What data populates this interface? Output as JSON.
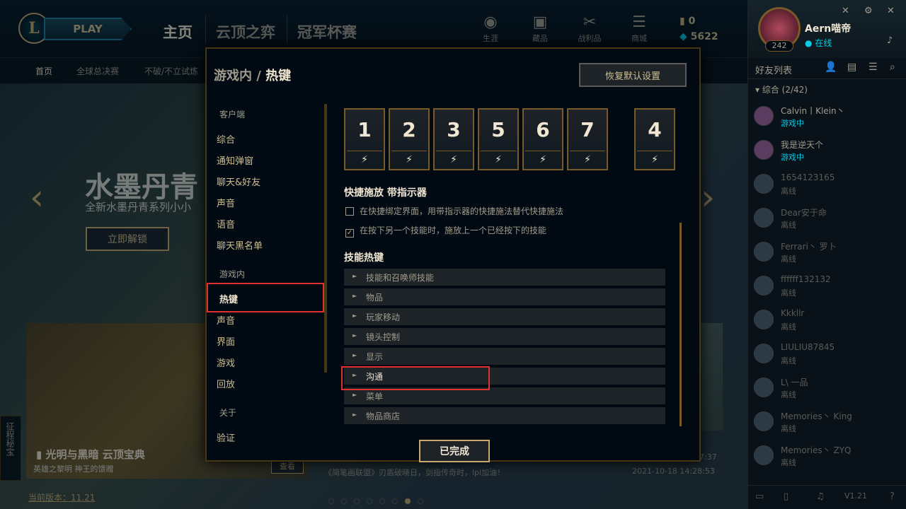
{
  "topbar": {
    "logo": "L",
    "play": "PLAY",
    "nav": [
      "主页",
      "云顶之弈",
      "冠军杯赛"
    ],
    "icons": [
      {
        "label": "生涯",
        "icon": "profile-icon"
      },
      {
        "label": "藏品",
        "icon": "collection-icon"
      },
      {
        "label": "战利品",
        "icon": "loot-icon"
      },
      {
        "label": "商城",
        "icon": "store-icon"
      }
    ],
    "blue_essence": "0",
    "rp": "5622"
  },
  "subnav": [
    "首页",
    "全球总决赛",
    "不破/不立试炼"
  ],
  "background": {
    "title": "水墨丹青",
    "subtitle": "全新水墨丹青系列小小",
    "unlock": "立即解锁",
    "card_title": "光明与黑暗 云顶宝典",
    "card_subtitle": "英雄之黎明 神王的馈赠",
    "card_btn": "查看",
    "news": "《简笔画联盟》刃盾破晓日，剑指传奇时，lpl加油！",
    "news_date": "2021-10-18 14:28:53",
    "news_date2": "7:37",
    "version": "当前版本：11.21",
    "sidetab": "征程秘宝"
  },
  "profile": {
    "name": "Aern喵帝",
    "status": "在线",
    "level": "242"
  },
  "friends": {
    "title": "好友列表",
    "group": "综合 (2/42)",
    "list": [
      {
        "name": "Calvin丨Klein丶",
        "status": "游戏中"
      },
      {
        "name": "我是逆天个",
        "status": "游戏中"
      },
      {
        "name": "1654123165",
        "status": "离线"
      },
      {
        "name": "Dear安于命",
        "status": "离线"
      },
      {
        "name": "Ferrari丶 罗卜",
        "status": "离线"
      },
      {
        "name": "ffffff132132",
        "status": "离线"
      },
      {
        "name": "Kkkllr",
        "status": "离线"
      },
      {
        "name": "LIULIU87845",
        "status": "离线"
      },
      {
        "name": "L\\ 一品",
        "status": "离线"
      },
      {
        "name": "Memories丶 King",
        "status": "离线"
      },
      {
        "name": "Memories丶 ZYQ",
        "status": "离线"
      }
    ],
    "footer_version": "V1.21"
  },
  "modal": {
    "breadcrumb_parent": "游戏内",
    "breadcrumb_sep": "/",
    "breadcrumb_current": "热键",
    "restore": "恢复默认设置",
    "menu_client": "客户端",
    "client_items": [
      "综合",
      "通知弹窗",
      "聊天&好友",
      "声音",
      "语音",
      "聊天黑名单"
    ],
    "menu_ingame": "游戏内",
    "ingame_items": [
      "热键",
      "声音",
      "界面",
      "游戏",
      "回放"
    ],
    "menu_about": "关于",
    "about_items": [
      "验证"
    ],
    "keys": [
      "1",
      "2",
      "3",
      "5",
      "6",
      "7",
      "4"
    ],
    "key_bottom": "⚡",
    "quickcast_title": "快捷施放 带指示器",
    "check1": "在快捷绑定界面，用带指示器的快捷施法替代快捷施法",
    "check1_checked": false,
    "check2": "在按下另一个技能时，施放上一个已经按下的技能",
    "check2_checked": true,
    "ability_title": "技能热键",
    "categories": [
      "技能和召唤师技能",
      "物品",
      "玩家移动",
      "镜头控制",
      "显示",
      "沟通",
      "菜单",
      "物品商店"
    ],
    "done": "已完成"
  }
}
